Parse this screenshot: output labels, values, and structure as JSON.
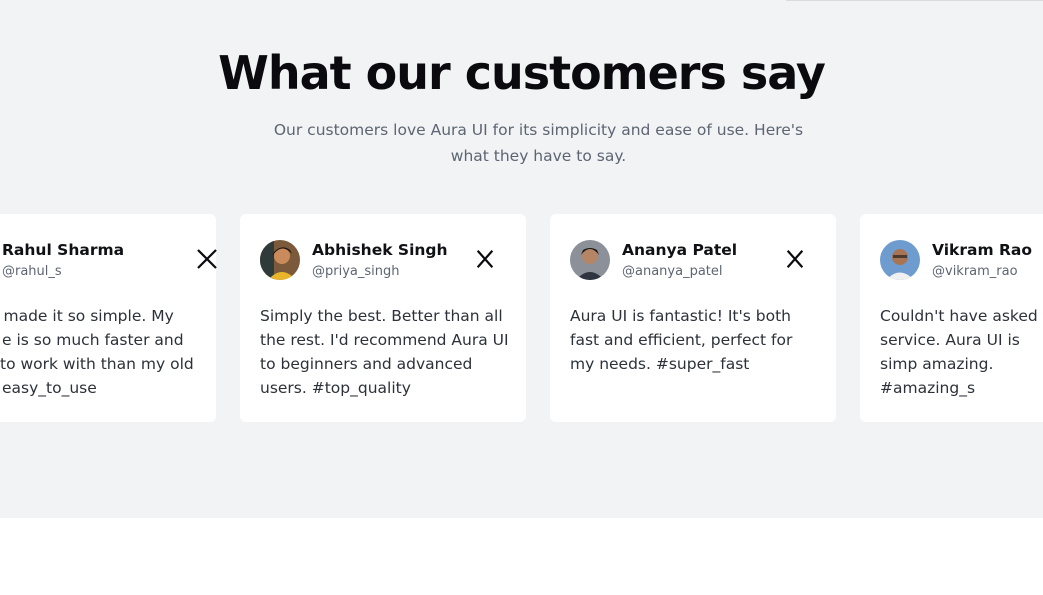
{
  "section": {
    "title": "What our customers say",
    "subtitle": "Our customers love Aura UI for its simplicity and ease of use. Here's what they have to say."
  },
  "testimonials": [
    {
      "name": "Rahul Sharma",
      "handle": "@rahul_s",
      "quote_lines": [
        "I made it so simple. My",
        "e is so much faster and",
        "to work with than my old",
        "easy_to_use"
      ],
      "icon": "x-logo-icon"
    },
    {
      "name": "Abhishek Singh",
      "handle": "@priya_singh",
      "quote": "Simply the best. Better than all the rest. I'd recommend Aura UI to beginners and advanced users. #top_quality",
      "icon": "x-logo-icon"
    },
    {
      "name": "Ananya Patel",
      "handle": "@ananya_patel",
      "quote": "Aura UI is fantastic! It's both fast and efficient, perfect for my needs. #super_fast",
      "icon": "x-logo-icon"
    },
    {
      "name": "Vikram Rao",
      "handle": "@vikram_rao",
      "quote": "Couldn't have asked f service. Aura UI is simp amazing. #amazing_s",
      "icon": "x-logo-icon"
    }
  ],
  "colors": {
    "section_bg": "#f2f3f5",
    "card_bg": "#ffffff",
    "title": "#0b0b0f",
    "muted": "#5d6572"
  }
}
